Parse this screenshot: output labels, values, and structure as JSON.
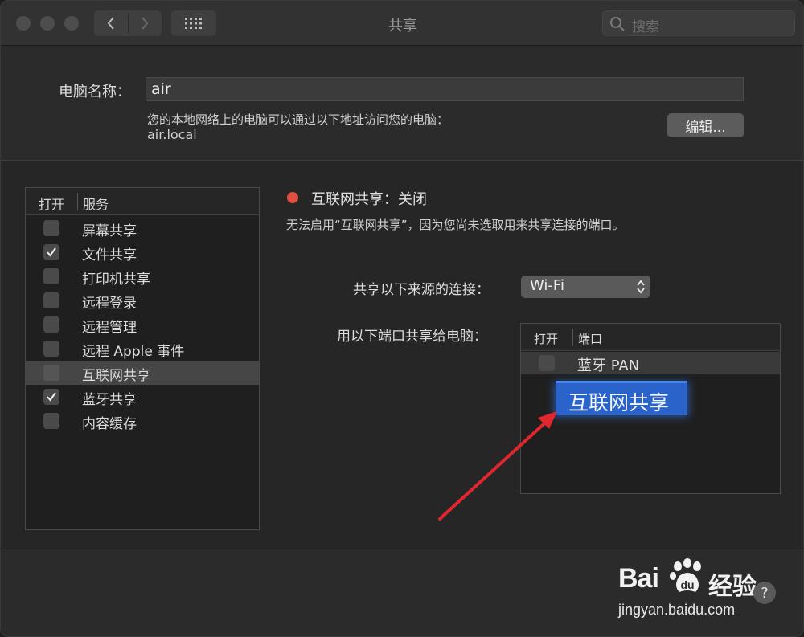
{
  "window": {
    "title": "共享"
  },
  "search": {
    "placeholder": "搜索"
  },
  "computer_name": {
    "label": "电脑名称：",
    "value": "air",
    "description": "您的本地网络上的电脑可以通过以下地址访问您的电脑：",
    "address": "air.local",
    "edit_label": "编辑..."
  },
  "services": {
    "header_on": "打开",
    "header_service": "服务",
    "items": [
      {
        "label": "屏幕共享",
        "checked": false
      },
      {
        "label": "文件共享",
        "checked": true
      },
      {
        "label": "打印机共享",
        "checked": false
      },
      {
        "label": "远程登录",
        "checked": false
      },
      {
        "label": "远程管理",
        "checked": false
      },
      {
        "label": "远程 Apple 事件",
        "checked": false
      },
      {
        "label": "互联网共享",
        "checked": false,
        "selected": true
      },
      {
        "label": "蓝牙共享",
        "checked": true
      },
      {
        "label": "内容缓存",
        "checked": false
      }
    ]
  },
  "detail": {
    "status": "互联网共享：关闭",
    "status_color": "#e0503f",
    "message": "无法启用“互联网共享”，因为您尚未选取用来共享连接的端口。",
    "from_label": "共享以下来源的连接：",
    "from_value": "Wi-Fi",
    "to_label": "用以下端口共享给电脑：",
    "ports": {
      "header_on": "打开",
      "header_port": "端口",
      "items": [
        {
          "label": "蓝牙 PAN",
          "checked": false
        }
      ]
    },
    "dragged_item": "互联网共享"
  },
  "watermark": {
    "logo": "Bai",
    "logo_cn": "经验",
    "url": "jingyan.baidu.com"
  },
  "help": {
    "label": "?"
  },
  "colors": {
    "accent": "#2a63c9",
    "annotation_arrow": "#e0262e"
  }
}
